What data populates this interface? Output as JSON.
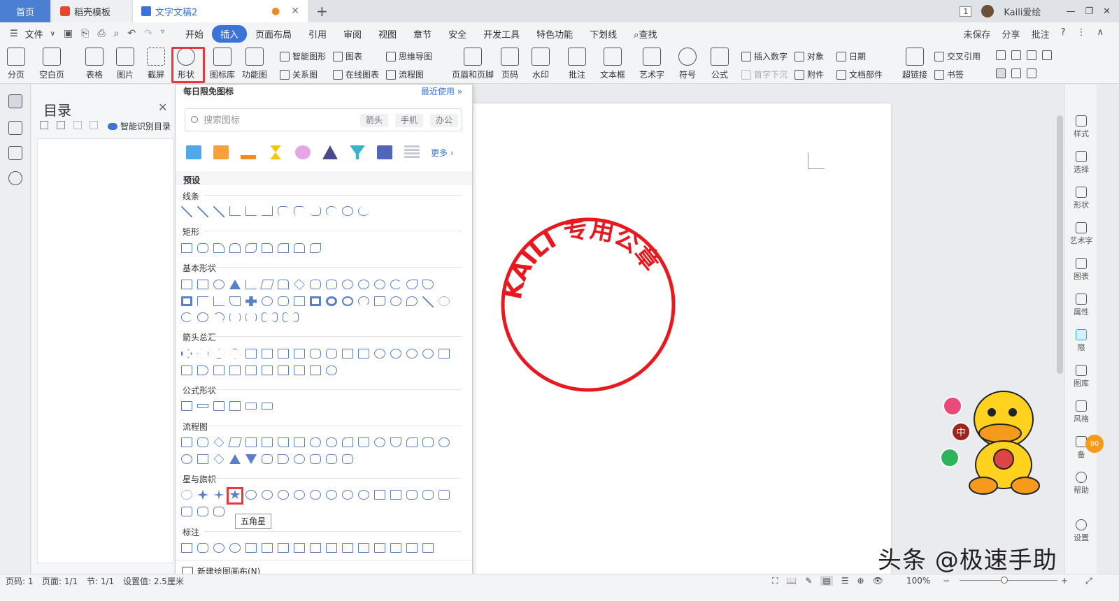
{
  "tabs": {
    "home": "首页",
    "doke": "稻壳模板",
    "doc": "文字文稿2"
  },
  "titlebar": {
    "page_badge": "1",
    "user": "Kaili爱绘"
  },
  "menubar": {
    "file": "文件",
    "items": [
      "开始",
      "插入",
      "页面布局",
      "引用",
      "审阅",
      "视图",
      "章节",
      "安全",
      "开发工具",
      "特色功能",
      "下划线"
    ],
    "search": "查找",
    "active": "插入",
    "right": [
      "未保存",
      "分享",
      "批注"
    ]
  },
  "ribbon": {
    "big": [
      "分页",
      "空白页",
      "表格",
      "图片",
      "截屏",
      "形状",
      "图标库",
      "功能图",
      "页眉和页脚",
      "页码",
      "水印",
      "批注",
      "文本框",
      "艺术字",
      "符号",
      "公式",
      "超链接"
    ],
    "small": {
      "smart_graph": "智能图形",
      "chart": "图表",
      "mindmap": "思维导图",
      "relation": "关系图",
      "online_chart": "在线图表",
      "flowchart": "流程图",
      "insert_number": "插入数字",
      "object": "对象",
      "date": "日期",
      "dropcap": "首字下沉",
      "attachment": "附件",
      "doc_parts": "文档部件",
      "cross_ref": "交叉引用",
      "bookmark": "书签"
    }
  },
  "toc": {
    "title": "目录",
    "smart": "智能识别目录"
  },
  "dropdown": {
    "header": "每日限免图标",
    "recent": "最近使用",
    "search_placeholder": "搜索图标",
    "chips": [
      "箭头",
      "手机",
      "办公"
    ],
    "more": "更多",
    "preset": "预设",
    "sections": [
      "线条",
      "矩形",
      "基本形状",
      "箭头总汇",
      "公式形状",
      "流程图",
      "星与旗帜",
      "标注"
    ],
    "tooltip": "五角星",
    "new_canvas": "新建绘图画布(N)"
  },
  "seal": {
    "text": "KAILI 专用公章",
    "color": "#e8181e"
  },
  "rightrail": [
    "样式",
    "选择",
    "形状",
    "艺术字",
    "图表",
    "属性",
    "限",
    "图库",
    "风格",
    "备",
    "帮助",
    "设置"
  ],
  "status": {
    "page": "页码: 1",
    "pages": "页面: 1/1",
    "section": "节: 1/1",
    "setting": "设置值: 2.5厘米",
    "zoom": "100%"
  },
  "watermark": "头条 @极速手助",
  "duck": {
    "badge1": "中",
    "score": "90"
  }
}
